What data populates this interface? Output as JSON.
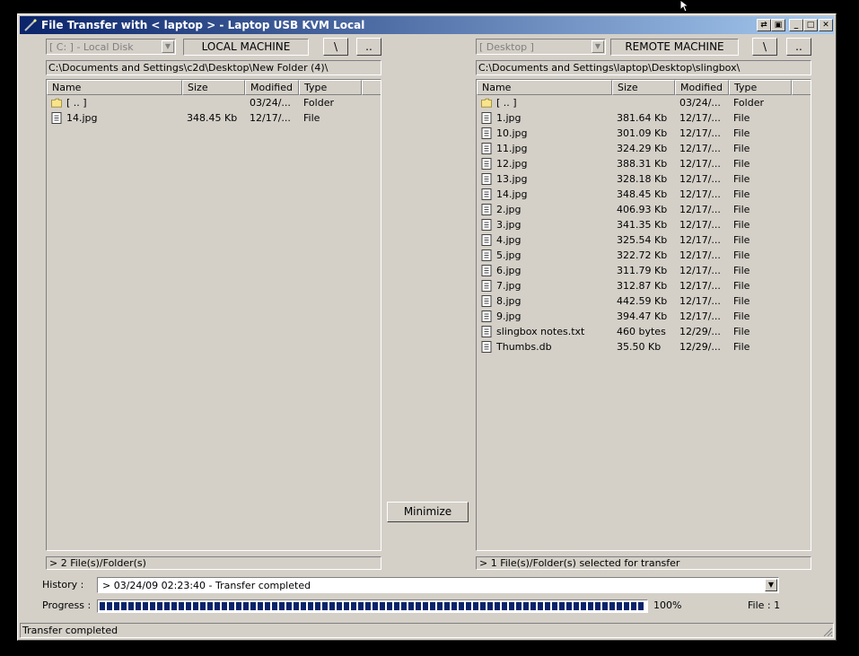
{
  "window": {
    "title": "File Transfer with < laptop >  -  Laptop USB KVM Local",
    "controls": [
      "restore-down",
      "pin",
      "minimize",
      "maximize",
      "close"
    ]
  },
  "local": {
    "drive": "[ C: ] - Local Disk",
    "label": "LOCAL MACHINE",
    "root_btn": "\\",
    "up_btn": "..",
    "path": "C:\\Documents and Settings\\c2d\\Desktop\\New Folder (4)\\",
    "columns": [
      "Name",
      "Size",
      "Modified",
      "Type"
    ],
    "rows": [
      {
        "icon": "folder-icon",
        "name": "[ .. ]",
        "size": "",
        "modified": "03/24/...",
        "type": "Folder"
      },
      {
        "icon": "file-icon",
        "name": "14.jpg",
        "size": "348.45 Kb",
        "modified": "12/17/...",
        "type": "File"
      }
    ],
    "status": "> 2 File(s)/Folder(s)"
  },
  "remote": {
    "drive": "[ Desktop ]",
    "label": "REMOTE MACHINE",
    "root_btn": "\\",
    "up_btn": "..",
    "path": "C:\\Documents and Settings\\laptop\\Desktop\\slingbox\\",
    "columns": [
      "Name",
      "Size",
      "Modified",
      "Type"
    ],
    "rows": [
      {
        "icon": "folder-icon",
        "name": "[ .. ]",
        "size": "",
        "modified": "03/24/...",
        "type": "Folder"
      },
      {
        "icon": "file-icon",
        "name": "1.jpg",
        "size": "381.64 Kb",
        "modified": "12/17/...",
        "type": "File"
      },
      {
        "icon": "file-icon",
        "name": "10.jpg",
        "size": "301.09 Kb",
        "modified": "12/17/...",
        "type": "File"
      },
      {
        "icon": "file-icon",
        "name": "11.jpg",
        "size": "324.29 Kb",
        "modified": "12/17/...",
        "type": "File"
      },
      {
        "icon": "file-icon",
        "name": "12.jpg",
        "size": "388.31 Kb",
        "modified": "12/17/...",
        "type": "File"
      },
      {
        "icon": "file-icon",
        "name": "13.jpg",
        "size": "328.18 Kb",
        "modified": "12/17/...",
        "type": "File"
      },
      {
        "icon": "file-icon",
        "name": "14.jpg",
        "size": "348.45 Kb",
        "modified": "12/17/...",
        "type": "File"
      },
      {
        "icon": "file-icon",
        "name": "2.jpg",
        "size": "406.93 Kb",
        "modified": "12/17/...",
        "type": "File"
      },
      {
        "icon": "file-icon",
        "name": "3.jpg",
        "size": "341.35 Kb",
        "modified": "12/17/...",
        "type": "File"
      },
      {
        "icon": "file-icon",
        "name": "4.jpg",
        "size": "325.54 Kb",
        "modified": "12/17/...",
        "type": "File"
      },
      {
        "icon": "file-icon",
        "name": "5.jpg",
        "size": "322.72 Kb",
        "modified": "12/17/...",
        "type": "File"
      },
      {
        "icon": "file-icon",
        "name": "6.jpg",
        "size": "311.79 Kb",
        "modified": "12/17/...",
        "type": "File"
      },
      {
        "icon": "file-icon",
        "name": "7.jpg",
        "size": "312.87 Kb",
        "modified": "12/17/...",
        "type": "File"
      },
      {
        "icon": "file-icon",
        "name": "8.jpg",
        "size": "442.59 Kb",
        "modified": "12/17/...",
        "type": "File"
      },
      {
        "icon": "file-icon",
        "name": "9.jpg",
        "size": "394.47 Kb",
        "modified": "12/17/...",
        "type": "File"
      },
      {
        "icon": "file-icon",
        "name": "slingbox notes.txt",
        "size": "460 bytes",
        "modified": "12/29/...",
        "type": "File"
      },
      {
        "icon": "file-icon",
        "name": "Thumbs.db",
        "size": "35.50 Kb",
        "modified": "12/29/...",
        "type": "File"
      }
    ],
    "status": "> 1 File(s)/Folder(s) selected for transfer"
  },
  "minimize_btn": "Minimize",
  "history": {
    "label": "History :",
    "value": "> 03/24/09 02:23:40 - Transfer completed"
  },
  "progress": {
    "label": "Progress :",
    "fraction": 1.0,
    "percent_text": "100%",
    "file_text": "File : 1"
  },
  "statusbar": "Transfer completed",
  "colors": {
    "titlebar_start": "#0a246a",
    "titlebar_end": "#a6caf0",
    "progress": "#0a246a",
    "face": "#d4d0c8"
  }
}
